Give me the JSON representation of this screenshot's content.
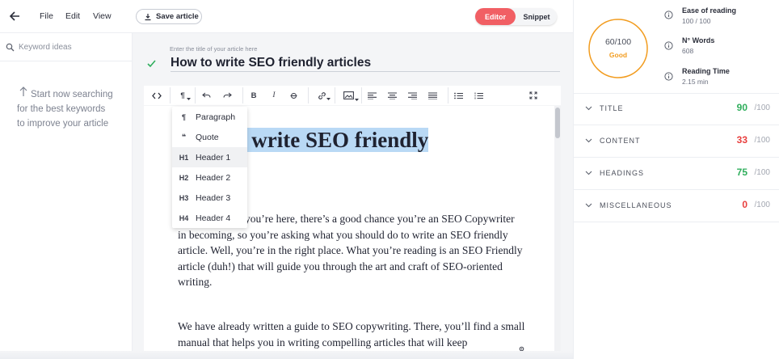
{
  "menu": {
    "file": "File",
    "edit": "Edit",
    "view": "View",
    "save_label": "Save article"
  },
  "mode_toggle": {
    "editor": "Editor",
    "snippet": "Snippet",
    "active_color": "#f15f64"
  },
  "keywords": {
    "placeholder": "Keyword ideas",
    "empty_message": "Start now searching for the best keywords to improve your article"
  },
  "article": {
    "title_hint": "Enter the title of your article here",
    "title": "How to write SEO friendly articles",
    "heading_line1": "o write SEO friendly",
    "heading_line2": "s",
    "paragraph1": "you’re here, there’s a good chance you’re an SEO Copywriter in becoming, so you’re asking what you should do to write an SEO friendly article. Well, you’re in the right place. What you’re reading is an SEO Friendly article (duh!) that will guide you through the art and craft of SEO-oriented writing.",
    "paragraph2": "We have already written a guide to SEO copywriting. There, you’ll find a small manual that helps you in writing compelling articles that will keep"
  },
  "format_menu": {
    "items": [
      {
        "icon": "¶",
        "label": "Paragraph"
      },
      {
        "icon": "❝",
        "label": "Quote"
      },
      {
        "icon": "H1",
        "label": "Header 1"
      },
      {
        "icon": "H2",
        "label": "Header 2"
      },
      {
        "icon": "H3",
        "label": "Header 3"
      },
      {
        "icon": "H4",
        "label": "Header 4"
      }
    ],
    "active_index": 2
  },
  "score": {
    "value": "60/100",
    "label": "Good",
    "fraction": 0.6,
    "color": "#f29c1f"
  },
  "stats": [
    {
      "icon": "info-icon",
      "label": "Ease of reading",
      "value": "100 / 100"
    },
    {
      "icon": "info-icon",
      "label": "N° Words",
      "value": "608"
    },
    {
      "icon": "info-icon",
      "label": "Reading Time",
      "value": "2.15 min"
    }
  ],
  "categories": [
    {
      "name": "TITLE",
      "score": "90",
      "max": "/100",
      "color": "#2fae5c"
    },
    {
      "name": "CONTENT",
      "score": "33",
      "max": "/100",
      "color": "#e8403f"
    },
    {
      "name": "HEADINGS",
      "score": "75",
      "max": "/100",
      "color": "#2fae5c"
    },
    {
      "name": "MISCELLANEOUS",
      "score": "0",
      "max": "/100",
      "color": "#e8403f"
    }
  ]
}
